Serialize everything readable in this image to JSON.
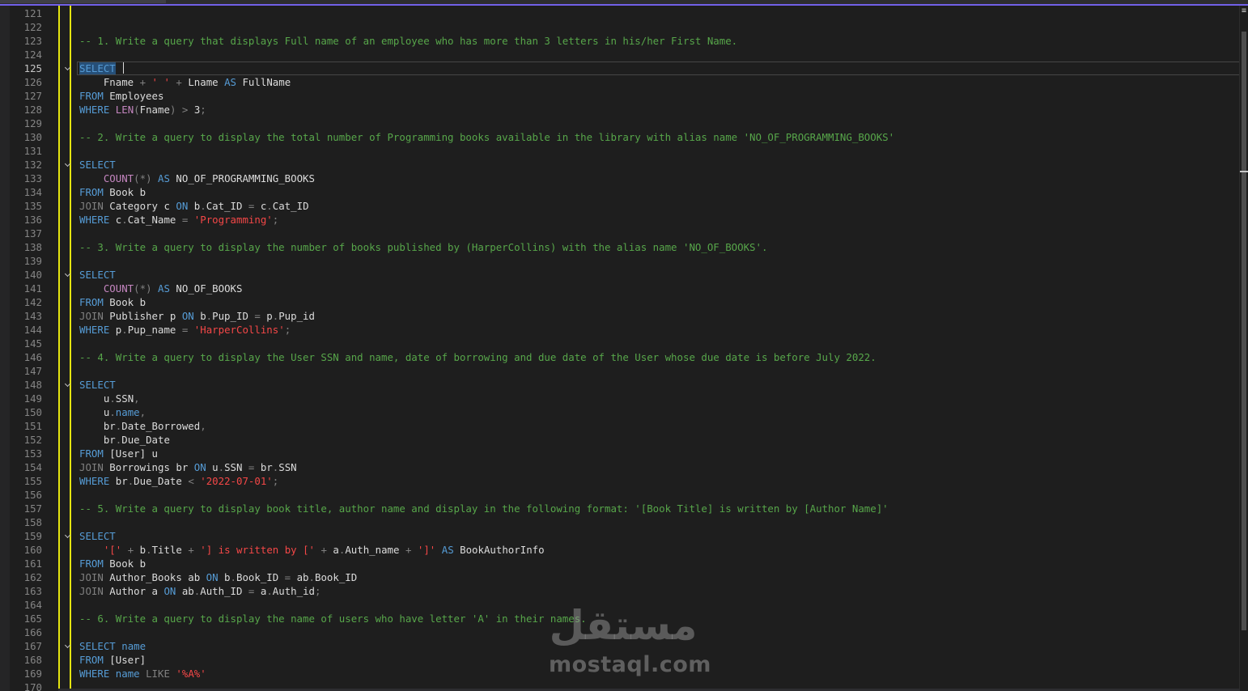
{
  "colors": {
    "background": "#1e1e1e",
    "keyword": "#569cd6",
    "function": "#c586c0",
    "string": "#f44747",
    "comment": "#57a64a",
    "line_number": "#858585",
    "accent": "#7160e8",
    "change_bar": "#e5e510"
  },
  "editor": {
    "active_line": "125",
    "lines": [
      {
        "n": "121",
        "tokens": []
      },
      {
        "n": "122",
        "tokens": []
      },
      {
        "n": "123",
        "tokens": [
          [
            "c",
            "-- 1. Write a query that displays Full name of an employee who has more than 3 letters in his/her First Name."
          ]
        ]
      },
      {
        "n": "124",
        "tokens": []
      },
      {
        "n": "125",
        "fold": true,
        "current": true,
        "tokens": [
          [
            "k sel-word",
            "SELECT"
          ],
          [
            "t",
            " "
          ]
        ]
      },
      {
        "n": "126",
        "tokens": [
          [
            "t",
            "    Fname "
          ],
          [
            "g",
            "+"
          ],
          [
            "t",
            " "
          ],
          [
            "s",
            "' '"
          ],
          [
            "t",
            " "
          ],
          [
            "g",
            "+"
          ],
          [
            "t",
            " Lname "
          ],
          [
            "k",
            "AS"
          ],
          [
            "t",
            " FullName"
          ]
        ]
      },
      {
        "n": "127",
        "tokens": [
          [
            "k",
            "FROM"
          ],
          [
            "t",
            " Employees"
          ]
        ]
      },
      {
        "n": "128",
        "tokens": [
          [
            "k",
            "WHERE"
          ],
          [
            "t",
            " "
          ],
          [
            "fn",
            "LEN"
          ],
          [
            "g",
            "("
          ],
          [
            "t",
            "Fname"
          ],
          [
            "g",
            ")"
          ],
          [
            "t",
            " "
          ],
          [
            "g",
            ">"
          ],
          [
            "t",
            " 3"
          ],
          [
            "g",
            ";"
          ]
        ]
      },
      {
        "n": "129",
        "tokens": []
      },
      {
        "n": "130",
        "tokens": [
          [
            "c",
            "-- 2. Write a query to display the total number of Programming books available in the library with alias name 'NO_OF_PROGRAMMING_BOOKS'"
          ]
        ]
      },
      {
        "n": "131",
        "tokens": []
      },
      {
        "n": "132",
        "fold": true,
        "tokens": [
          [
            "k",
            "SELECT"
          ]
        ]
      },
      {
        "n": "133",
        "tokens": [
          [
            "t",
            "    "
          ],
          [
            "fn",
            "COUNT"
          ],
          [
            "g",
            "(*)"
          ],
          [
            "t",
            " "
          ],
          [
            "k",
            "AS"
          ],
          [
            "t",
            " NO_OF_PROGRAMMING_BOOKS"
          ]
        ]
      },
      {
        "n": "134",
        "tokens": [
          [
            "k",
            "FROM"
          ],
          [
            "t",
            " Book b"
          ]
        ]
      },
      {
        "n": "135",
        "tokens": [
          [
            "g",
            "JOIN"
          ],
          [
            "t",
            " Category c "
          ],
          [
            "k",
            "ON"
          ],
          [
            "t",
            " b"
          ],
          [
            "g",
            "."
          ],
          [
            "t",
            "Cat_ID "
          ],
          [
            "g",
            "="
          ],
          [
            "t",
            " c"
          ],
          [
            "g",
            "."
          ],
          [
            "t",
            "Cat_ID"
          ]
        ]
      },
      {
        "n": "136",
        "tokens": [
          [
            "k",
            "WHERE"
          ],
          [
            "t",
            " c"
          ],
          [
            "g",
            "."
          ],
          [
            "t",
            "Cat_Name "
          ],
          [
            "g",
            "="
          ],
          [
            "t",
            " "
          ],
          [
            "s",
            "'Programming'"
          ],
          [
            "g",
            ";"
          ]
        ]
      },
      {
        "n": "137",
        "tokens": []
      },
      {
        "n": "138",
        "tokens": [
          [
            "c",
            "-- 3. Write a query to display the number of books published by (HarperCollins) with the alias name 'NO_OF_BOOKS'."
          ]
        ]
      },
      {
        "n": "139",
        "tokens": []
      },
      {
        "n": "140",
        "fold": true,
        "tokens": [
          [
            "k",
            "SELECT"
          ]
        ]
      },
      {
        "n": "141",
        "tokens": [
          [
            "t",
            "    "
          ],
          [
            "fn",
            "COUNT"
          ],
          [
            "g",
            "(*)"
          ],
          [
            "t",
            " "
          ],
          [
            "k",
            "AS"
          ],
          [
            "t",
            " NO_OF_BOOKS"
          ]
        ]
      },
      {
        "n": "142",
        "tokens": [
          [
            "k",
            "FROM"
          ],
          [
            "t",
            " Book b"
          ]
        ]
      },
      {
        "n": "143",
        "tokens": [
          [
            "g",
            "JOIN"
          ],
          [
            "t",
            " Publisher p "
          ],
          [
            "k",
            "ON"
          ],
          [
            "t",
            " b"
          ],
          [
            "g",
            "."
          ],
          [
            "t",
            "Pup_ID "
          ],
          [
            "g",
            "="
          ],
          [
            "t",
            " p"
          ],
          [
            "g",
            "."
          ],
          [
            "t",
            "Pup_id"
          ]
        ]
      },
      {
        "n": "144",
        "tokens": [
          [
            "k",
            "WHERE"
          ],
          [
            "t",
            " p"
          ],
          [
            "g",
            "."
          ],
          [
            "t",
            "Pup_name "
          ],
          [
            "g",
            "="
          ],
          [
            "t",
            " "
          ],
          [
            "s",
            "'HarperCollins'"
          ],
          [
            "g",
            ";"
          ]
        ]
      },
      {
        "n": "145",
        "tokens": []
      },
      {
        "n": "146",
        "tokens": [
          [
            "c",
            "-- 4. Write a query to display the User SSN and name, date of borrowing and due date of the User whose due date is before July 2022."
          ]
        ]
      },
      {
        "n": "147",
        "tokens": []
      },
      {
        "n": "148",
        "fold": true,
        "tokens": [
          [
            "k",
            "SELECT"
          ]
        ]
      },
      {
        "n": "149",
        "tokens": [
          [
            "t",
            "    u"
          ],
          [
            "g",
            "."
          ],
          [
            "t",
            "SSN"
          ],
          [
            "g",
            ","
          ]
        ]
      },
      {
        "n": "150",
        "tokens": [
          [
            "t",
            "    u"
          ],
          [
            "g",
            "."
          ],
          [
            "k",
            "name"
          ],
          [
            "g",
            ","
          ]
        ]
      },
      {
        "n": "151",
        "tokens": [
          [
            "t",
            "    br"
          ],
          [
            "g",
            "."
          ],
          [
            "t",
            "Date_Borrowed"
          ],
          [
            "g",
            ","
          ]
        ]
      },
      {
        "n": "152",
        "tokens": [
          [
            "t",
            "    br"
          ],
          [
            "g",
            "."
          ],
          [
            "t",
            "Due_Date"
          ]
        ]
      },
      {
        "n": "153",
        "tokens": [
          [
            "k",
            "FROM"
          ],
          [
            "t",
            " [User] u"
          ]
        ]
      },
      {
        "n": "154",
        "tokens": [
          [
            "g",
            "JOIN"
          ],
          [
            "t",
            " Borrowings br "
          ],
          [
            "k",
            "ON"
          ],
          [
            "t",
            " u"
          ],
          [
            "g",
            "."
          ],
          [
            "t",
            "SSN "
          ],
          [
            "g",
            "="
          ],
          [
            "t",
            " br"
          ],
          [
            "g",
            "."
          ],
          [
            "t",
            "SSN"
          ]
        ]
      },
      {
        "n": "155",
        "tokens": [
          [
            "k",
            "WHERE"
          ],
          [
            "t",
            " br"
          ],
          [
            "g",
            "."
          ],
          [
            "t",
            "Due_Date "
          ],
          [
            "g",
            "<"
          ],
          [
            "t",
            " "
          ],
          [
            "s",
            "'2022-07-01'"
          ],
          [
            "g",
            ";"
          ]
        ]
      },
      {
        "n": "156",
        "tokens": []
      },
      {
        "n": "157",
        "tokens": [
          [
            "c",
            "-- 5. Write a query to display book title, author name and display in the following format: '[Book Title] is written by [Author Name]'"
          ]
        ]
      },
      {
        "n": "158",
        "tokens": []
      },
      {
        "n": "159",
        "fold": true,
        "tokens": [
          [
            "k",
            "SELECT"
          ]
        ]
      },
      {
        "n": "160",
        "tokens": [
          [
            "t",
            "    "
          ],
          [
            "s",
            "'['"
          ],
          [
            "t",
            " "
          ],
          [
            "g",
            "+"
          ],
          [
            "t",
            " b"
          ],
          [
            "g",
            "."
          ],
          [
            "t",
            "Title "
          ],
          [
            "g",
            "+"
          ],
          [
            "t",
            " "
          ],
          [
            "s",
            "'] is written by ['"
          ],
          [
            "t",
            " "
          ],
          [
            "g",
            "+"
          ],
          [
            "t",
            " a"
          ],
          [
            "g",
            "."
          ],
          [
            "t",
            "Auth_name "
          ],
          [
            "g",
            "+"
          ],
          [
            "t",
            " "
          ],
          [
            "s",
            "']'"
          ],
          [
            "t",
            " "
          ],
          [
            "k",
            "AS"
          ],
          [
            "t",
            " BookAuthorInfo"
          ]
        ]
      },
      {
        "n": "161",
        "tokens": [
          [
            "k",
            "FROM"
          ],
          [
            "t",
            " Book b"
          ]
        ]
      },
      {
        "n": "162",
        "tokens": [
          [
            "g",
            "JOIN"
          ],
          [
            "t",
            " Author_Books ab "
          ],
          [
            "k",
            "ON"
          ],
          [
            "t",
            " b"
          ],
          [
            "g",
            "."
          ],
          [
            "t",
            "Book_ID "
          ],
          [
            "g",
            "="
          ],
          [
            "t",
            " ab"
          ],
          [
            "g",
            "."
          ],
          [
            "t",
            "Book_ID"
          ]
        ]
      },
      {
        "n": "163",
        "tokens": [
          [
            "g",
            "JOIN"
          ],
          [
            "t",
            " Author a "
          ],
          [
            "k",
            "ON"
          ],
          [
            "t",
            " ab"
          ],
          [
            "g",
            "."
          ],
          [
            "t",
            "Auth_ID "
          ],
          [
            "g",
            "="
          ],
          [
            "t",
            " a"
          ],
          [
            "g",
            "."
          ],
          [
            "t",
            "Auth_id"
          ],
          [
            "g",
            ";"
          ]
        ]
      },
      {
        "n": "164",
        "tokens": []
      },
      {
        "n": "165",
        "tokens": [
          [
            "c",
            "-- 6. Write a query to display the name of users who have letter 'A' in their names."
          ]
        ]
      },
      {
        "n": "166",
        "tokens": []
      },
      {
        "n": "167",
        "fold": true,
        "tokens": [
          [
            "k",
            "SELECT"
          ],
          [
            "t",
            " "
          ],
          [
            "k",
            "name"
          ]
        ]
      },
      {
        "n": "168",
        "tokens": [
          [
            "k",
            "FROM"
          ],
          [
            "t",
            " [User]"
          ]
        ]
      },
      {
        "n": "169",
        "tokens": [
          [
            "k",
            "WHERE"
          ],
          [
            "t",
            " "
          ],
          [
            "k",
            "name"
          ],
          [
            "t",
            " "
          ],
          [
            "g",
            "LIKE"
          ],
          [
            "t",
            " "
          ],
          [
            "s",
            "'%A%'"
          ]
        ]
      },
      {
        "n": "170",
        "tokens": []
      }
    ]
  },
  "icons": {
    "fold": "chevron-down-icon",
    "split": "split-editor-icon"
  },
  "watermark": {
    "arabic": "مستقل",
    "latin": "mostaql.com"
  }
}
